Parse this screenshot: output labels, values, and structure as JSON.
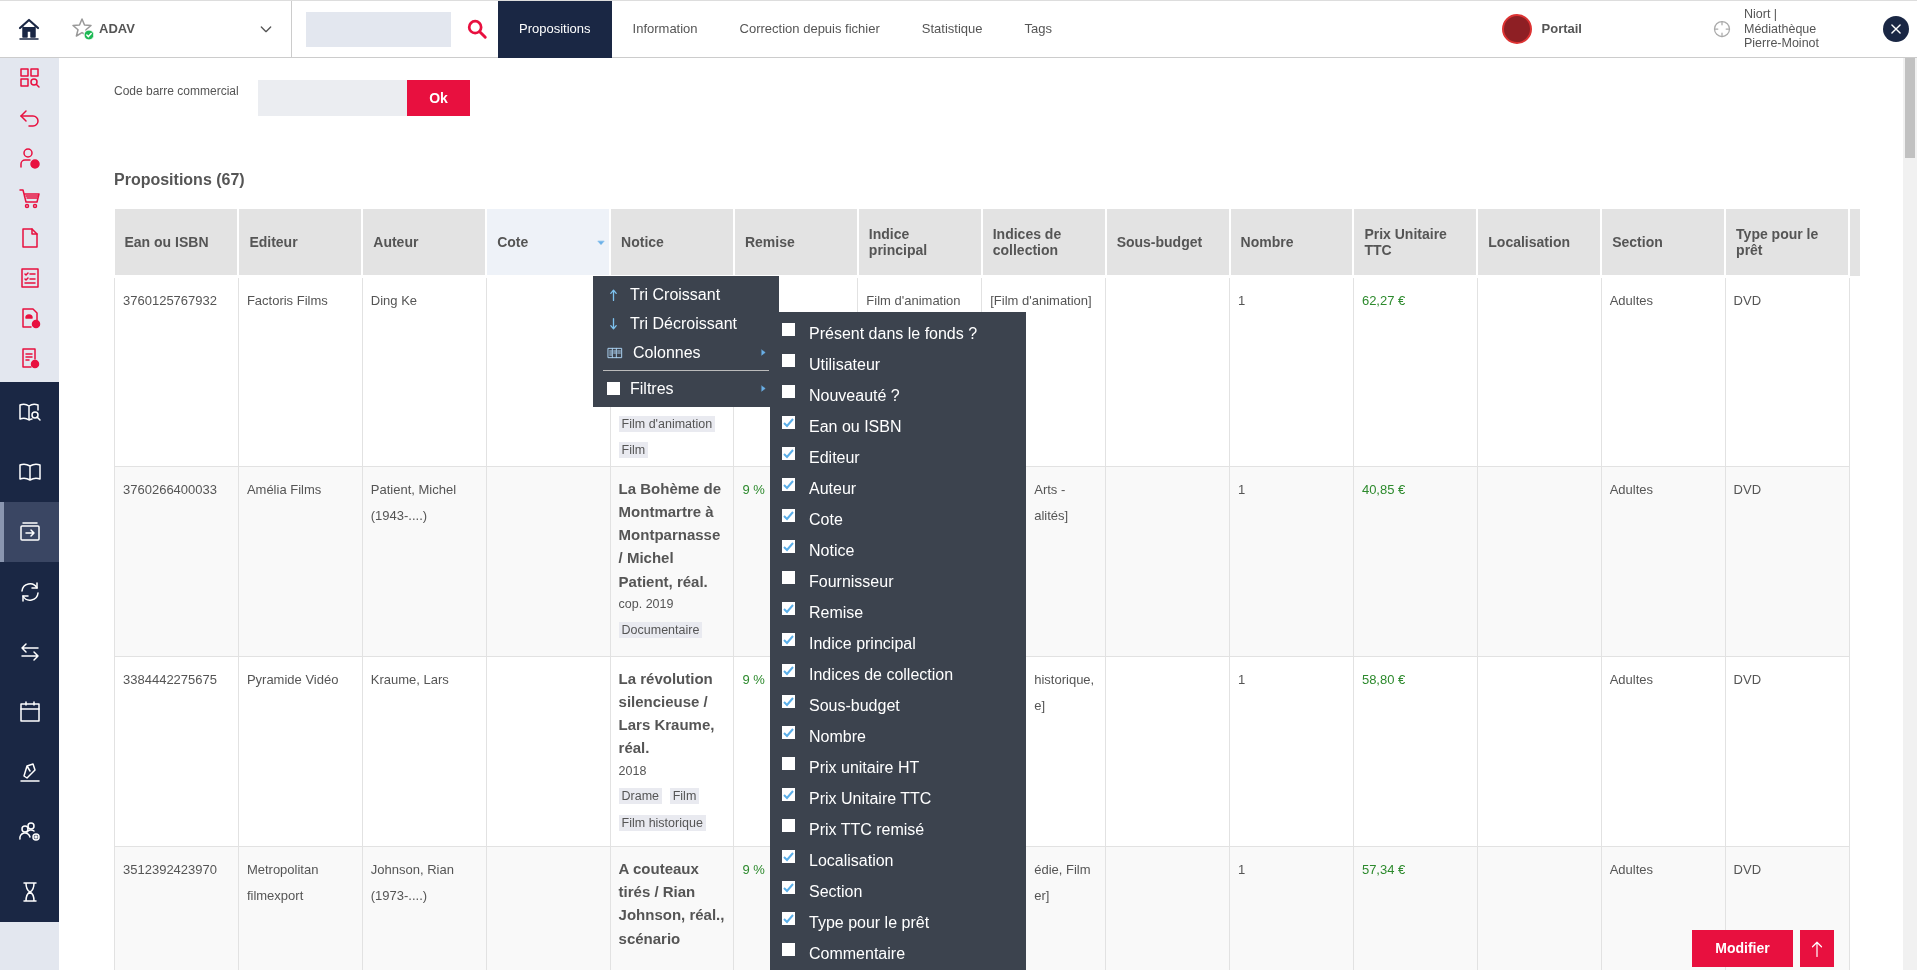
{
  "topbar": {
    "library": "ADAV",
    "tabs": [
      {
        "label": "Propositions",
        "selected": true
      },
      {
        "label": "Information",
        "selected": false
      },
      {
        "label": "Correction depuis fichier",
        "selected": false
      },
      {
        "label": "Statistique",
        "selected": false
      },
      {
        "label": "Tags",
        "selected": false
      }
    ],
    "portal": "Portail",
    "location": "Niort | Médiathèque Pierre-Moinot"
  },
  "sidebar": {
    "groups": [
      {
        "kind": "tools",
        "items": [
          {
            "selected": false
          },
          {
            "selected": false
          },
          {
            "selected": false
          },
          {
            "selected": false
          },
          {
            "selected": false
          },
          {
            "selected": false
          },
          {
            "selected": false
          },
          {
            "selected": false
          }
        ]
      },
      {
        "kind": "modules",
        "items": [
          {
            "selected": false
          },
          {
            "selected": false
          },
          {
            "selected": true
          },
          {
            "selected": false
          },
          {
            "selected": false
          },
          {
            "selected": false
          },
          {
            "selected": false
          },
          {
            "selected": false
          },
          {
            "selected": false
          }
        ]
      }
    ]
  },
  "barcode": {
    "label": "Code barre commercial",
    "button": "Ok"
  },
  "section_title": "Propositions (67)",
  "table": {
    "columns": [
      {
        "label": "Ean ou ISBN",
        "menu_open": false
      },
      {
        "label": "Editeur",
        "menu_open": false
      },
      {
        "label": "Auteur",
        "menu_open": false
      },
      {
        "label": "Cote",
        "menu_open": true
      },
      {
        "label": "Notice",
        "menu_open": false
      },
      {
        "label": "Remise",
        "menu_open": false
      },
      {
        "label": "Indice principal",
        "menu_open": false
      },
      {
        "label": "Indices de collection",
        "menu_open": false
      },
      {
        "label": "Sous-budget",
        "menu_open": false
      },
      {
        "label": "Nombre",
        "menu_open": false
      },
      {
        "label": "Prix Unitaire TTC",
        "menu_open": false
      },
      {
        "label": "Localisation",
        "menu_open": false
      },
      {
        "label": "Section",
        "menu_open": false
      },
      {
        "label": "Type pour le prêt",
        "menu_open": false
      }
    ],
    "rows": [
      {
        "ean": "3760125767932",
        "editeur": "Factoris Films",
        "auteur": "Ding Ke",
        "notice": {
          "tags": [
            "Film d'animation",
            "Film"
          ]
        },
        "indice_principal": "Film d'animation",
        "indices_collection": [
          "[Film d'animation]"
        ],
        "nombre": "1",
        "prix": "62,27 €",
        "section": "Adultes",
        "type": "DVD"
      },
      {
        "ean": "3760266400033",
        "editeur": "Amélia Films",
        "auteur": "Patient, Michel (1943-....)",
        "notice": {
          "title": "La Bohème de Montmartre à Montparnasse / Michel Patient, réal.",
          "year": "cop. 2019",
          "tags": [
            "Documentaire"
          ]
        },
        "remise": "9 %",
        "indices_collection": [
          "Arts -",
          "alités]"
        ],
        "nombre": "1",
        "prix": "40,85 €",
        "section": "Adultes",
        "type": "DVD"
      },
      {
        "ean": "3384442275675",
        "editeur": "Pyramide Vidéo",
        "auteur": "Kraume, Lars",
        "notice": {
          "title": "La révolution silencieuse / Lars Kraume, réal.",
          "year": "2018",
          "tags": [
            "Drame",
            "Film",
            "Film historique"
          ]
        },
        "remise": "9 %",
        "indices_collection": [
          "historique,",
          "e]"
        ],
        "nombre": "1",
        "prix": "58,80 €",
        "section": "Adultes",
        "type": "DVD"
      },
      {
        "ean": "3512392423970",
        "editeur": "Metropolitan filmexport",
        "auteur": "Johnson, Rian (1973-....)",
        "notice": {
          "title": "A couteaux tirés / Rian Johnson, réal., scénario"
        },
        "remise": "9 %",
        "indices_collection": [
          "édie, Film",
          "er]"
        ],
        "nombre": "1",
        "prix": "57,34 €",
        "section": "Adultes",
        "type": "DVD"
      }
    ]
  },
  "column_menu": {
    "items": [
      {
        "kind": "sort-asc",
        "label": "Tri Croissant"
      },
      {
        "kind": "sort-desc",
        "label": "Tri Décroissant"
      },
      {
        "kind": "columns",
        "label": "Colonnes",
        "options": [
          {
            "label": "Présent dans le fonds ?",
            "checked": false
          },
          {
            "label": "Utilisateur",
            "checked": false
          },
          {
            "label": "Nouveauté ?",
            "checked": false
          },
          {
            "label": "Ean ou ISBN",
            "checked": true
          },
          {
            "label": "Editeur",
            "checked": true
          },
          {
            "label": "Auteur",
            "checked": true
          },
          {
            "label": "Cote",
            "checked": true
          },
          {
            "label": "Notice",
            "checked": true
          },
          {
            "label": "Fournisseur",
            "checked": false
          },
          {
            "label": "Remise",
            "checked": true
          },
          {
            "label": "Indice principal",
            "checked": true
          },
          {
            "label": "Indices de collection",
            "checked": true
          },
          {
            "label": "Sous-budget",
            "checked": true
          },
          {
            "label": "Nombre",
            "checked": true
          },
          {
            "label": "Prix unitaire HT",
            "checked": false
          },
          {
            "label": "Prix Unitaire TTC",
            "checked": true
          },
          {
            "label": "Prix TTC remisé",
            "checked": false
          },
          {
            "label": "Localisation",
            "checked": true
          },
          {
            "label": "Section",
            "checked": true
          },
          {
            "label": "Type pour le prêt",
            "checked": true
          },
          {
            "label": "Commentaire",
            "checked": false
          }
        ]
      },
      {
        "kind": "filters",
        "label": "Filtres",
        "checked": false
      }
    ]
  },
  "actions": {
    "primary": "Modifier"
  }
}
